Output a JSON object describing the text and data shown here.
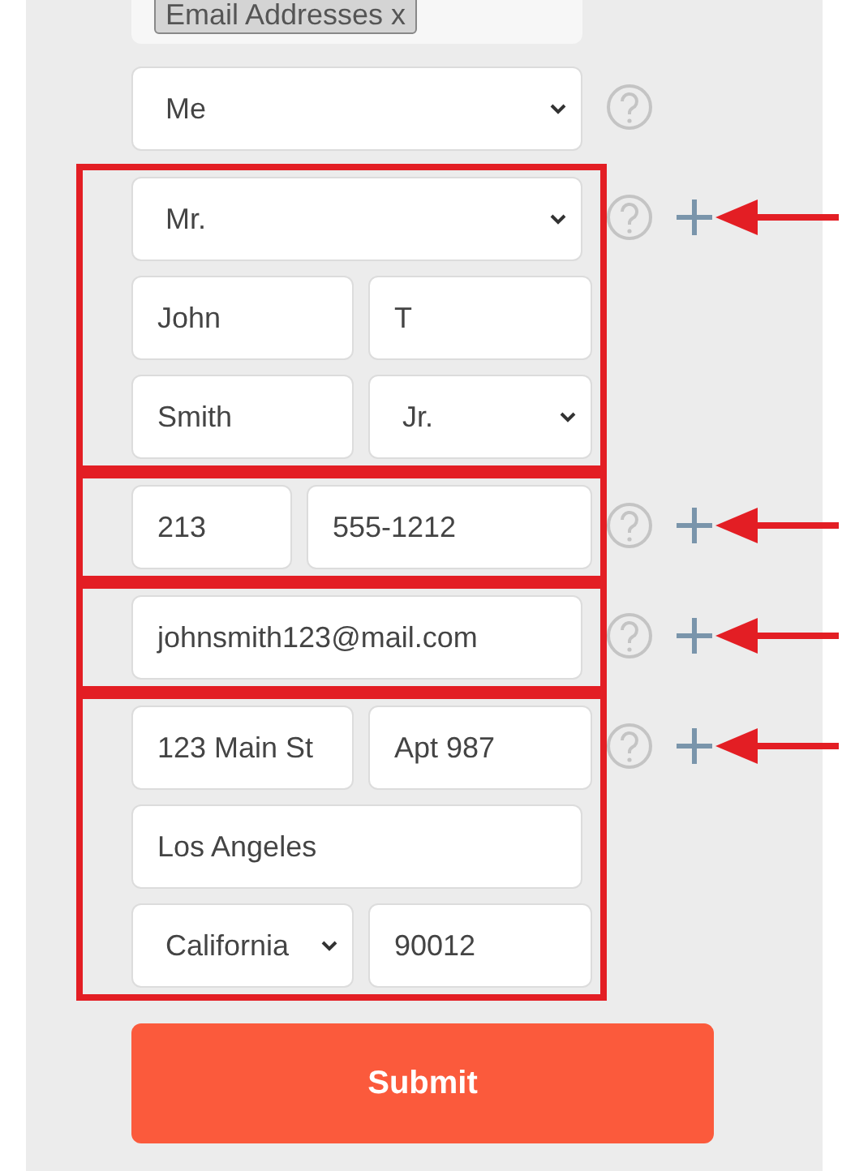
{
  "tag_field": {
    "tags": [
      "Email Addresses x"
    ]
  },
  "groups": [
    {
      "highlighted": false,
      "help": true,
      "add": false,
      "rows": [
        {
          "kind": "single",
          "fields": [
            {
              "kind": "select",
              "value": "Me"
            }
          ]
        }
      ]
    },
    {
      "highlighted": true,
      "help": true,
      "add": true,
      "rows": [
        {
          "kind": "single",
          "fields": [
            {
              "kind": "select",
              "value": "Mr."
            }
          ]
        },
        {
          "kind": "pair",
          "fields": [
            {
              "kind": "input",
              "value": "John"
            },
            {
              "kind": "input",
              "value": "T"
            }
          ]
        },
        {
          "kind": "pair",
          "fields": [
            {
              "kind": "input",
              "value": "Smith"
            },
            {
              "kind": "select",
              "value": "Jr."
            }
          ]
        }
      ]
    },
    {
      "highlighted": true,
      "help": true,
      "add": true,
      "rows": [
        {
          "kind": "phone",
          "fields": [
            {
              "kind": "input",
              "value": "213"
            },
            {
              "kind": "input",
              "value": "555-1212"
            }
          ]
        }
      ]
    },
    {
      "highlighted": true,
      "help": true,
      "add": true,
      "rows": [
        {
          "kind": "single",
          "fields": [
            {
              "kind": "input",
              "value": "johnsmith123@mail.com"
            }
          ]
        }
      ]
    },
    {
      "highlighted": true,
      "help": true,
      "add": true,
      "rows": [
        {
          "kind": "pair",
          "fields": [
            {
              "kind": "input",
              "value": "123 Main St"
            },
            {
              "kind": "input",
              "value": "Apt 987"
            }
          ]
        },
        {
          "kind": "single",
          "fields": [
            {
              "kind": "input",
              "value": "Los Angeles"
            }
          ]
        },
        {
          "kind": "pair",
          "fields": [
            {
              "kind": "select",
              "value": "California"
            },
            {
              "kind": "input",
              "value": "90012"
            }
          ]
        }
      ]
    }
  ],
  "submit": {
    "label": "Submit"
  }
}
